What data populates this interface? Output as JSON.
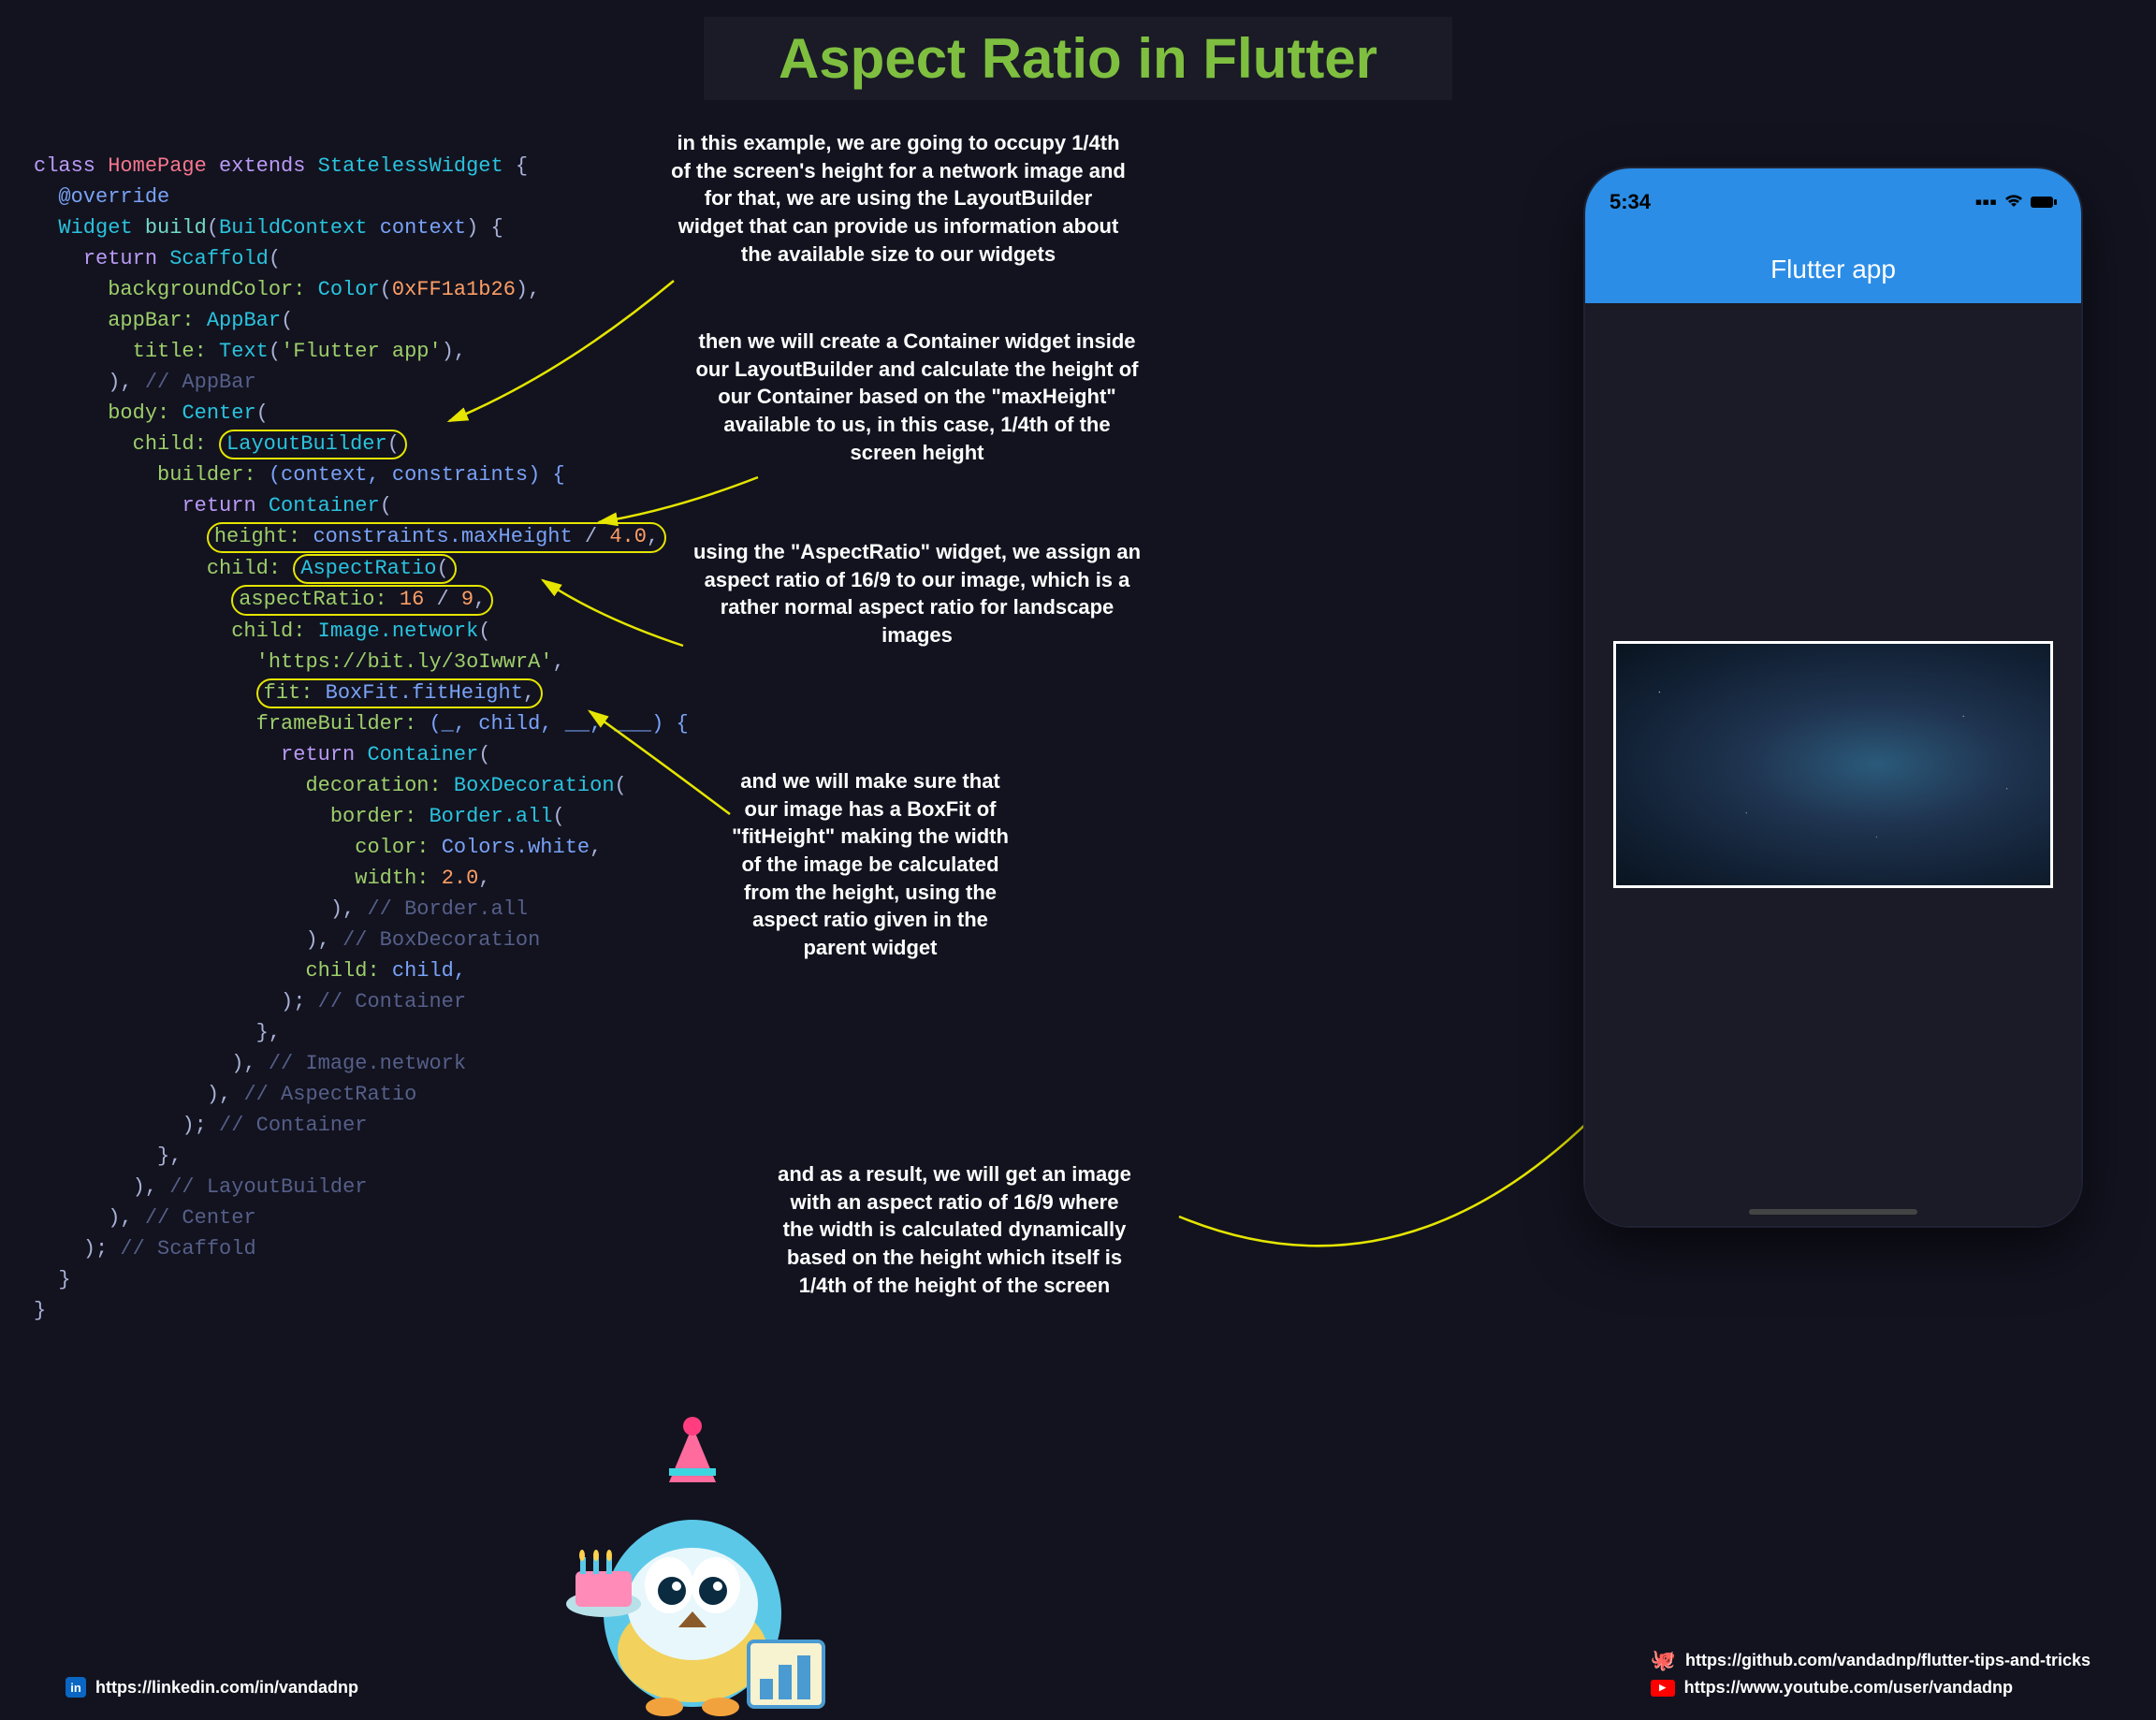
{
  "title": "Aspect Ratio in Flutter",
  "phone": {
    "time": "5:34",
    "appbar_title": "Flutter app"
  },
  "code": {
    "l1_class": "class ",
    "l1_name": "HomePage ",
    "l1_ext": "extends ",
    "l1_super": "StatelessWidget ",
    "l1_brace": "{",
    "l2_anno": "@override",
    "l3_type": "Widget ",
    "l3_fn": "build",
    "l3_p1": "(",
    "l3_bc": "BuildContext ",
    "l3_ctx": "context",
    "l3_p2": ") {",
    "l4_ret": "return ",
    "l4_scaf": "Scaffold",
    "l4_p": "(",
    "l5_prop": "backgroundColor: ",
    "l5_col": "Color",
    "l5_p": "(",
    "l5_hex": "0xFF1a1b26",
    "l5_c": "),",
    "l6_prop": "appBar: ",
    "l6_ab": "AppBar",
    "l6_p": "(",
    "l7_prop": "title: ",
    "l7_txt": "Text",
    "l7_p": "(",
    "l7_str": "'Flutter app'",
    "l7_c": "),",
    "l8_c": "), ",
    "l8_cmt": "// AppBar",
    "l9_prop": "body: ",
    "l9_ctr": "Center",
    "l9_p": "(",
    "l10_prop": "child: ",
    "l10_lb": "LayoutBuilder",
    "l10_p": "(",
    "l11_prop": "builder: ",
    "l11_args": "(context, constraints) {",
    "l12_ret": "return ",
    "l12_ctn": "Container",
    "l12_p": "(",
    "l13_prop": "height: ",
    "l13_expr": "constraints.maxHeight ",
    "l13_div": "/ ",
    "l13_num": "4.0",
    "l13_c": ",",
    "l14_prop": "child: ",
    "l14_ar": "AspectRatio",
    "l14_p": "(",
    "l15_prop": "aspectRatio: ",
    "l15_a": "16",
    "l15_d": " / ",
    "l15_b": "9",
    "l15_c": ",",
    "l16_prop": "child: ",
    "l16_img": "Image.network",
    "l16_p": "(",
    "l17_url": "'https://bit.ly/3oIwwrA'",
    "l17_c": ",",
    "l18_prop": "fit: ",
    "l18_bf": "BoxFit.fitHeight",
    "l18_c": ",",
    "l19_prop": "frameBuilder: ",
    "l19_args": "(_, child, __, ___) {",
    "l20_ret": "return ",
    "l20_ctn": "Container",
    "l20_p": "(",
    "l21_prop": "decoration: ",
    "l21_bd": "BoxDecoration",
    "l21_p": "(",
    "l22_prop": "border: ",
    "l22_ba": "Border.all",
    "l22_p": "(",
    "l23_prop": "color: ",
    "l23_cw": "Colors.white",
    "l23_c": ",",
    "l24_prop": "width: ",
    "l24_num": "2.0",
    "l24_c": ",",
    "l25_c": "), ",
    "l25_cmt": "// Border.all",
    "l26_c": "), ",
    "l26_cmt": "// BoxDecoration",
    "l27_prop": "child: ",
    "l27_child": "child,",
    "l28_c": "); ",
    "l28_cmt": "// Container",
    "l29_c": "},",
    "l30_c": "), ",
    "l30_cmt": "// Image.network",
    "l31_c": "), ",
    "l31_cmt": "// AspectRatio",
    "l32_c": "); ",
    "l32_cmt": "// Container",
    "l33_c": "},",
    "l34_c": "), ",
    "l34_cmt": "// LayoutBuilder",
    "l35_c": "), ",
    "l35_cmt": "// Center",
    "l36_c": "); ",
    "l36_cmt": "// Scaffold",
    "l37_c": "}",
    "l38_c": "}"
  },
  "notes": {
    "n1": "in this example, we are going to occupy 1/4th\nof the screen's height for a network image and\nfor that, we are using the LayoutBuilder\nwidget that can provide us information about\nthe available size to our widgets",
    "n2": "then we will create a Container widget inside\nour LayoutBuilder and calculate the height of\nour Container based on the \"maxHeight\"\navailable to us, in this case, 1/4th of the\nscreen height",
    "n3": "using the \"AspectRatio\" widget, we assign an\naspect ratio of 16/9 to our image, which is a\nrather normal aspect ratio for landscape\nimages",
    "n4": "and we will make sure that\nour image has a BoxFit of\n\"fitHeight\" making the width\nof the image be calculated\nfrom the height, using the\naspect ratio given in the\nparent widget",
    "n5": "and as a result, we will get an image\nwith an aspect ratio of 16/9 where\nthe width is calculated dynamically\nbased on the height which itself is\n1/4th of the height of the screen"
  },
  "links": {
    "linkedin": "https://linkedin.com/in/vandadnp",
    "github": "https://github.com/vandadnp/flutter-tips-and-tricks",
    "youtube": "https://www.youtube.com/user/vandadnp"
  }
}
